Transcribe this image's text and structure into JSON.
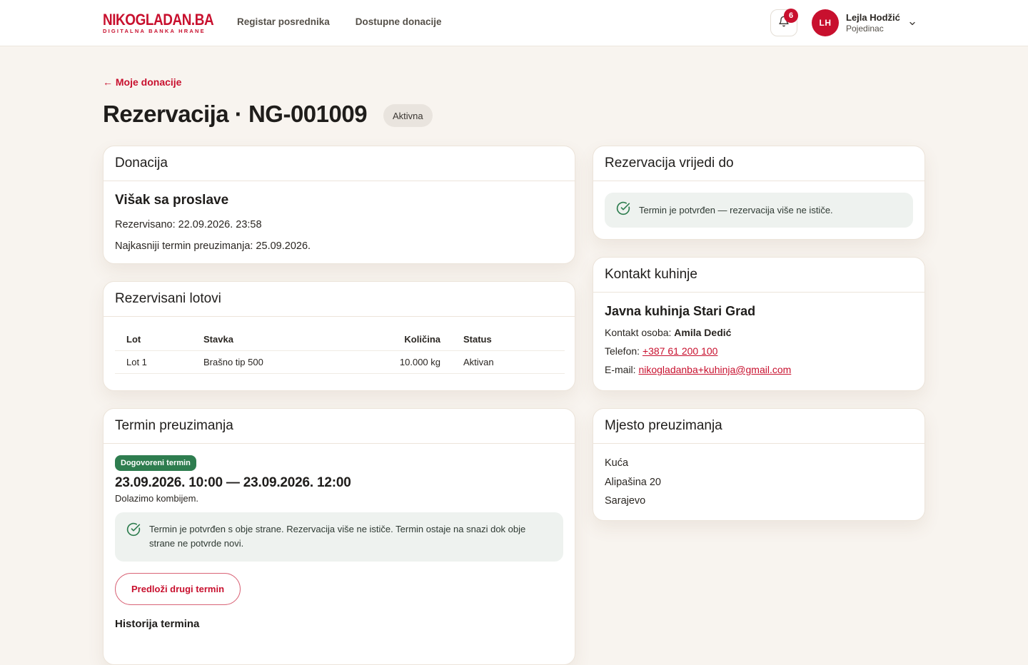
{
  "header": {
    "logo_main_left": "NIKOGLADAN",
    "logo_main_right": ".BA",
    "logo_sub": "DIGITALNA BANKA HRANE",
    "nav": [
      "Registar posrednika",
      "Dostupne donacije"
    ],
    "notifications_count": "6",
    "user": {
      "initials": "LH",
      "name": "Lejla Hodžić",
      "role": "Pojedinac"
    }
  },
  "page": {
    "back_link": "← Moje donacije",
    "title": "Rezervacija · NG-001009",
    "status": "Aktivna"
  },
  "donacija": {
    "heading": "Donacija",
    "title": "Višak sa proslave",
    "reserved": "Rezervisano: 22.09.2026. 23:58",
    "latest": "Najkasniji termin preuzimanja: 25.09.2026."
  },
  "lotovi": {
    "heading": "Rezervisani lotovi",
    "columns": [
      "Lot",
      "Stavka",
      "Količina",
      "Status"
    ],
    "rows": [
      [
        "Lot 1",
        "Brašno tip 500",
        "10.000 kg",
        "Aktivan"
      ]
    ]
  },
  "termin": {
    "heading": "Termin preuzimanja",
    "tag": "Dogovoreni termin",
    "range": "23.09.2026. 10:00 — 23.09.2026. 12:00",
    "note": "Dolazimo kombijem.",
    "confirmation": "Termin je potvrđen s obje strane. Rezervacija više ne ističe. Termin ostaje na snazi dok obje strane ne potvrde novi.",
    "propose_button": "Predloži drugi termin",
    "history_title": "Historija termina"
  },
  "vrijedi": {
    "heading": "Rezervacija vrijedi do",
    "message": "Termin je potvrđen — rezervacija više ne ističe."
  },
  "kontakt": {
    "heading": "Kontakt kuhinje",
    "name": "Javna kuhinja Stari Grad",
    "person_label": "Kontakt osoba:",
    "person": "Amila Dedić",
    "phone_label": "Telefon:",
    "phone": "+387 61 200 100",
    "email_label": "E-mail:",
    "email": "nikogladanba+kuhinja@gmail.com"
  },
  "mjesto": {
    "heading": "Mjesto preuzimanja",
    "lines": [
      "Kuća",
      "Alipašina 20",
      "Sarajevo"
    ]
  },
  "colors": {
    "brand": "#c8102e",
    "success": "#2e7d4f",
    "background": "#f8f4ef"
  }
}
